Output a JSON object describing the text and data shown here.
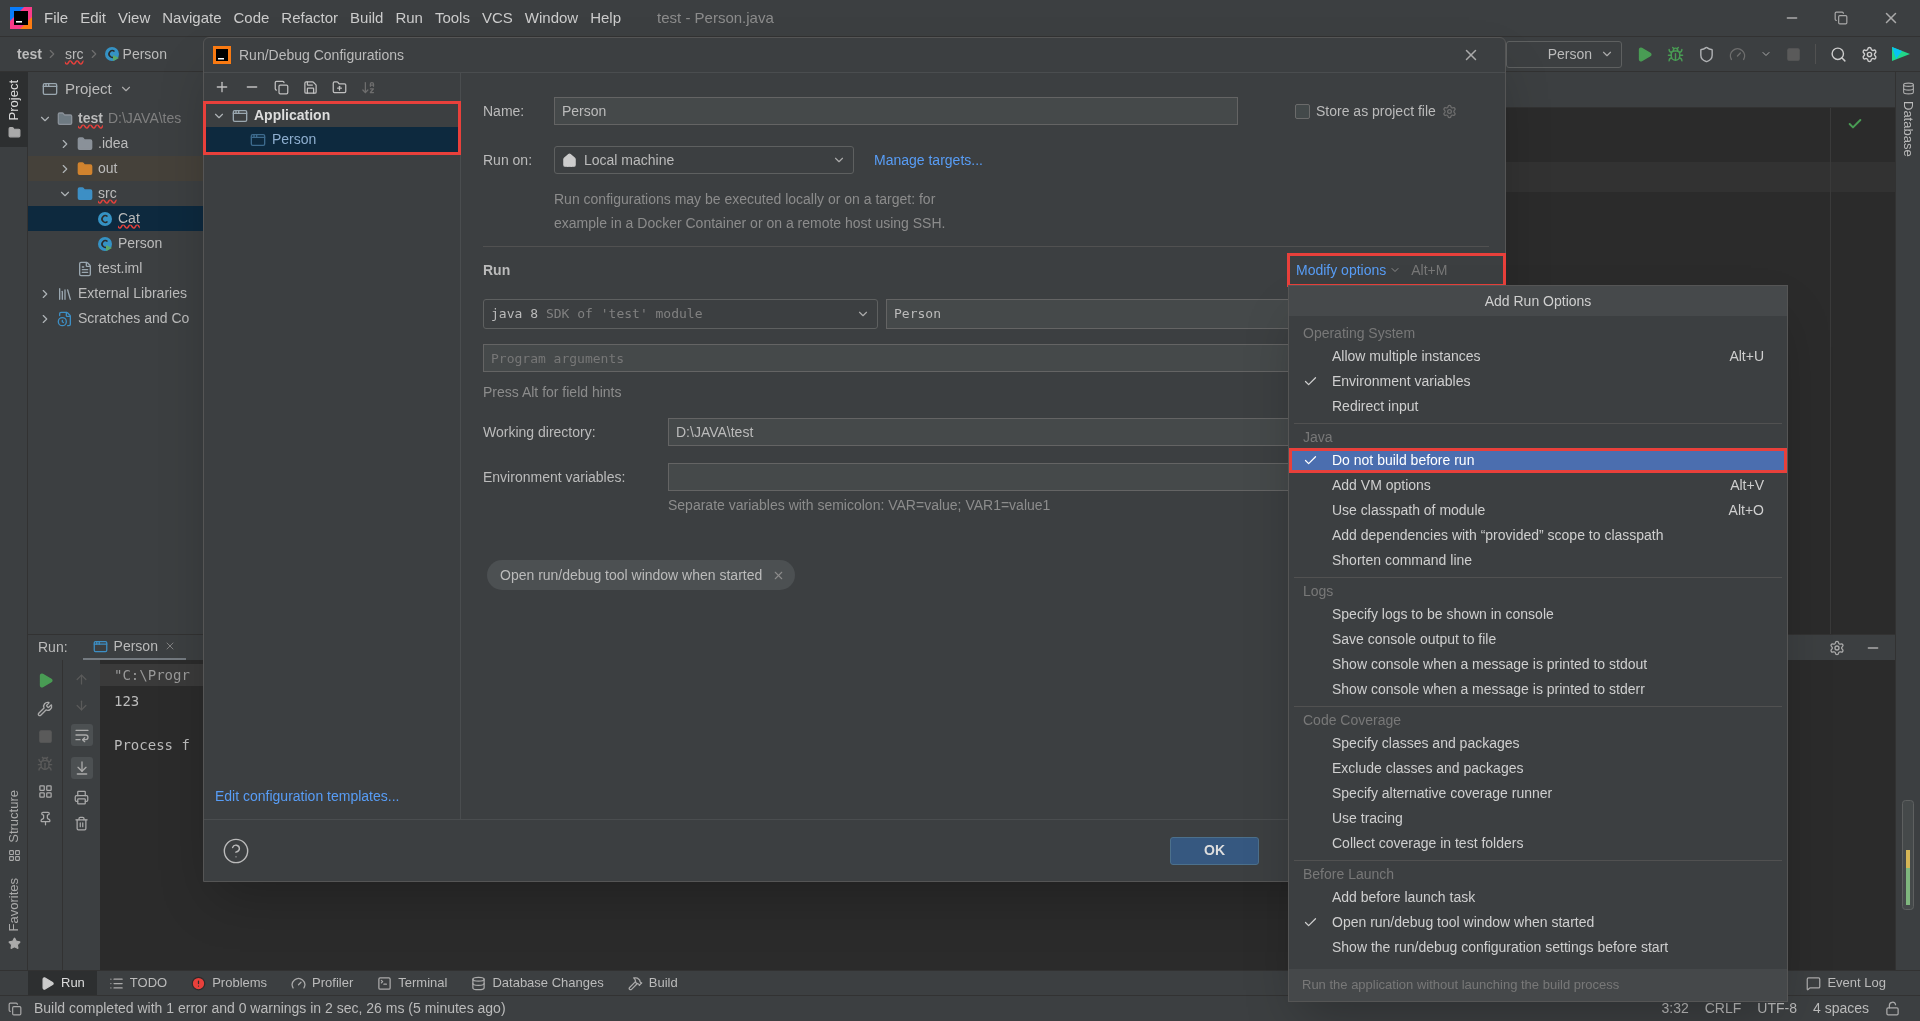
{
  "menu_bar": {
    "items": [
      "File",
      "Edit",
      "View",
      "Navigate",
      "Code",
      "Refactor",
      "Build",
      "Run",
      "Tools",
      "VCS",
      "Window",
      "Help"
    ],
    "title": "test - Person.java"
  },
  "navigation_bar": {
    "breadcrumbs": [
      {
        "label": "test",
        "error": false
      },
      {
        "label": "src",
        "error": true
      },
      {
        "label": "Person",
        "error": false
      }
    ],
    "run_configuration": "Person"
  },
  "left_stripe": {
    "top": [
      {
        "label": "Project",
        "selected": true
      }
    ],
    "bottom": [
      {
        "label": "Structure",
        "selected": false
      },
      {
        "label": "Favorites",
        "selected": false
      }
    ]
  },
  "right_stripe": {
    "tabs": [
      "Database"
    ]
  },
  "project_panel": {
    "title": "Project",
    "tree": [
      {
        "label": "test",
        "detail": "D:\\JAVA\\tes",
        "kind": "module",
        "expanded": true,
        "selected": false,
        "error": true,
        "children": [
          {
            "label": ".idea",
            "kind": "folder",
            "expanded": false,
            "selected": false,
            "error": false
          },
          {
            "label": "out",
            "kind": "excluded_folder",
            "expanded": false,
            "selected": false,
            "error": false
          },
          {
            "label": "src",
            "kind": "source_folder",
            "expanded": true,
            "selected": false,
            "error": true,
            "children": [
              {
                "label": "Cat",
                "kind": "class",
                "selected": true,
                "error": true
              },
              {
                "label": "Person",
                "kind": "main_class",
                "selected": false,
                "error": false
              }
            ]
          },
          {
            "label": "test.iml",
            "kind": "module_file",
            "selected": false,
            "error": false
          }
        ]
      },
      {
        "label": "External Libraries",
        "kind": "libraries",
        "expanded": false,
        "selected": false,
        "error": false
      },
      {
        "label": "Scratches and Co",
        "kind": "scratches",
        "expanded": false,
        "selected": false,
        "error": false
      }
    ]
  },
  "run_panel": {
    "label": "Run:",
    "tabs": [
      {
        "label": "Person",
        "selected": true
      }
    ],
    "console": [
      {
        "kind": "command",
        "text": "\"C:\\Progr"
      },
      {
        "kind": "output",
        "text": "123"
      },
      {
        "kind": "exit",
        "text": "Process f"
      }
    ]
  },
  "bottom_tool_tabs": [
    {
      "label": "Run",
      "kind": "run",
      "selected": true
    },
    {
      "label": "TODO",
      "kind": "todo",
      "selected": false
    },
    {
      "label": "Problems",
      "kind": "problems",
      "selected": false
    },
    {
      "label": "Profiler",
      "kind": "profiler",
      "selected": false
    },
    {
      "label": "Terminal",
      "kind": "terminal",
      "selected": false
    },
    {
      "label": "Database Changes",
      "kind": "database",
      "selected": false
    },
    {
      "label": "Build",
      "kind": "build",
      "selected": false
    }
  ],
  "event_log": "Event Log",
  "status_bar": {
    "message": "Build completed with 1 error and 0 warnings in 2 sec, 26 ms (5 minutes ago)",
    "widgets": [
      "3:32",
      "CRLF",
      "UTF-8",
      "4 spaces"
    ]
  },
  "dialog": {
    "title": "Run/Debug Configurations",
    "tree": {
      "annotated": true,
      "items": [
        {
          "label": "Application",
          "expanded": true,
          "selected": false,
          "children": [
            {
              "label": "Person",
              "selected": true
            }
          ]
        }
      ]
    },
    "templates_link": "Edit configuration templates...",
    "name": {
      "label": "Name:",
      "value": "Person"
    },
    "store_as_project_file": {
      "label": "Store as project file",
      "checked": false
    },
    "run_on": {
      "label": "Run on:",
      "value": "Local machine",
      "link": "Manage targets...",
      "description": "Run configurations may be executed locally or on a target: for example in a Docker Container or on a remote host using SSH."
    },
    "run_section": {
      "title": "Run",
      "modify_options": {
        "label": "Modify options",
        "shortcut": "Alt+M",
        "annotated": true
      },
      "jre": {
        "value": "java 8",
        "detail": "SDK of 'test' module"
      },
      "main_class": "Person",
      "program_arguments": {
        "placeholder": "Program arguments"
      },
      "field_hint": "Press Alt for field hints",
      "working_directory": {
        "label": "Working directory:",
        "value": "D:\\JAVA\\test"
      },
      "environment_variables": {
        "label": "Environment variables:",
        "hint": "Separate variables with semicolon: VAR=value; VAR1=value1"
      },
      "chips": [
        {
          "label": "Open run/debug tool window when started"
        }
      ]
    },
    "buttons": [
      "OK"
    ]
  },
  "popup": {
    "title": "Add Run Options",
    "groups": [
      {
        "title": "Operating System",
        "items": [
          {
            "label": "Allow multiple instances",
            "shortcut": "Alt+U",
            "checked": false,
            "selected": false,
            "annotated": false
          },
          {
            "label": "Environment variables",
            "checked": true,
            "selected": false,
            "annotated": false
          },
          {
            "label": "Redirect input",
            "checked": false,
            "selected": false,
            "annotated": false
          }
        ]
      },
      {
        "title": "Java",
        "items": [
          {
            "label": "Do not build before run",
            "checked": true,
            "selected": true,
            "annotated": true
          },
          {
            "label": "Add VM options",
            "shortcut": "Alt+V",
            "checked": false,
            "selected": false,
            "annotated": false
          },
          {
            "label": "Use classpath of module",
            "shortcut": "Alt+O",
            "checked": false,
            "selected": false,
            "annotated": false
          },
          {
            "label": "Add dependencies with “provided” scope to classpath",
            "checked": false,
            "selected": false,
            "annotated": false
          },
          {
            "label": "Shorten command line",
            "checked": false,
            "selected": false,
            "annotated": false
          }
        ]
      },
      {
        "title": "Logs",
        "items": [
          {
            "label": "Specify logs to be shown in console",
            "checked": false,
            "selected": false,
            "annotated": false
          },
          {
            "label": "Save console output to file",
            "checked": false,
            "selected": false,
            "annotated": false
          },
          {
            "label": "Show console when a message is printed to stdout",
            "checked": false,
            "selected": false,
            "annotated": false
          },
          {
            "label": "Show console when a message is printed to stderr",
            "checked": false,
            "selected": false,
            "annotated": false
          }
        ]
      },
      {
        "title": "Code Coverage",
        "items": [
          {
            "label": "Specify classes and packages",
            "checked": false,
            "selected": false,
            "annotated": false
          },
          {
            "label": "Exclude classes and packages",
            "checked": false,
            "selected": false,
            "annotated": false
          },
          {
            "label": "Specify alternative coverage runner",
            "checked": false,
            "selected": false,
            "annotated": false
          },
          {
            "label": "Use tracing",
            "checked": false,
            "selected": false,
            "annotated": false
          },
          {
            "label": "Collect coverage in test folders",
            "checked": false,
            "selected": false,
            "annotated": false
          }
        ]
      },
      {
        "title": "Before Launch",
        "items": [
          {
            "label": "Add before launch task",
            "checked": false,
            "selected": false,
            "annotated": false
          },
          {
            "label": "Open run/debug tool window when started",
            "checked": true,
            "selected": false,
            "annotated": false
          },
          {
            "label": "Show the run/debug configuration settings before start",
            "checked": false,
            "selected": false,
            "annotated": false
          }
        ]
      }
    ],
    "footer": "Run the application without launching the build process"
  }
}
